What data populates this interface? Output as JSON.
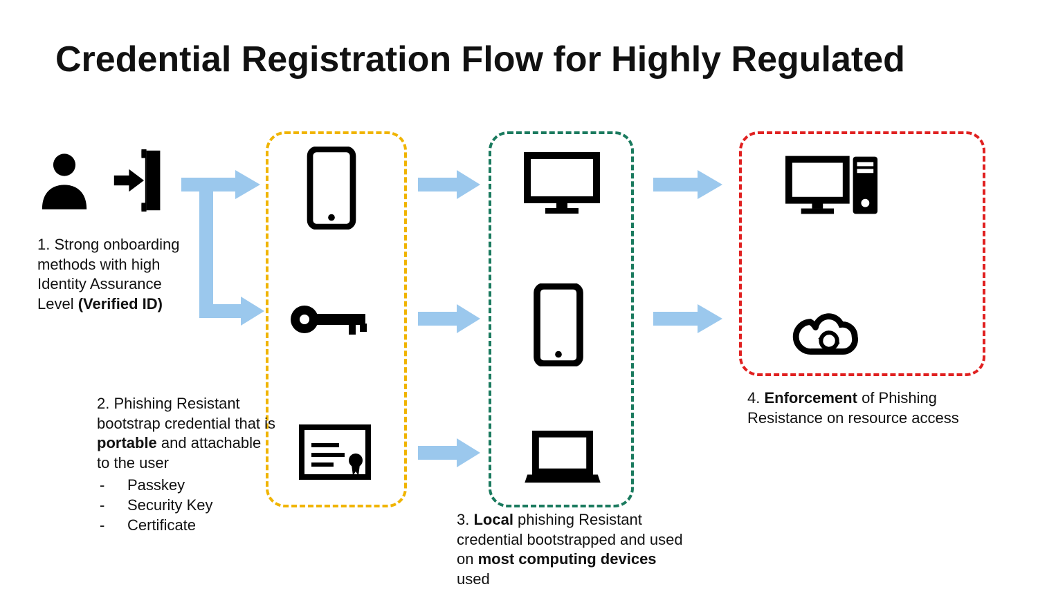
{
  "title": "Credential Registration Flow for Highly Regulated",
  "steps": {
    "s1": {
      "prefix": "1. Strong onboarding methods with high Identity Assurance Level ",
      "bold": "(Verified ID)"
    },
    "s2": {
      "line1a": "2. Phishing Resistant bootstrap credential that is ",
      "line1b": "portable",
      "line1c": " and attachable to the user",
      "items": [
        "Passkey",
        "Security Key",
        "Certificate"
      ]
    },
    "s3": {
      "a": "3. ",
      "b": "Local",
      "c": " phishing Resistant credential bootstrapped and used on ",
      "d": "most computing devices",
      "e": " used"
    },
    "s4": {
      "a": "4. ",
      "b": "Enforcement",
      "c": " of Phishing Resistance on resource access"
    }
  },
  "colors": {
    "arrow": "#9bc8ed",
    "boxYellow": "#f0b400",
    "boxGreen": "#1a7a5e",
    "boxRed": "#e02020"
  },
  "icons": {
    "user": "user-icon",
    "login": "login-door-icon",
    "phone": "phone-icon",
    "key": "key-icon",
    "certificate": "certificate-icon",
    "monitor": "monitor-icon",
    "phone2": "phone-icon",
    "laptop": "laptop-icon",
    "pcTower": "pc-tower-icon",
    "cloudSync": "cloud-sync-icon"
  }
}
